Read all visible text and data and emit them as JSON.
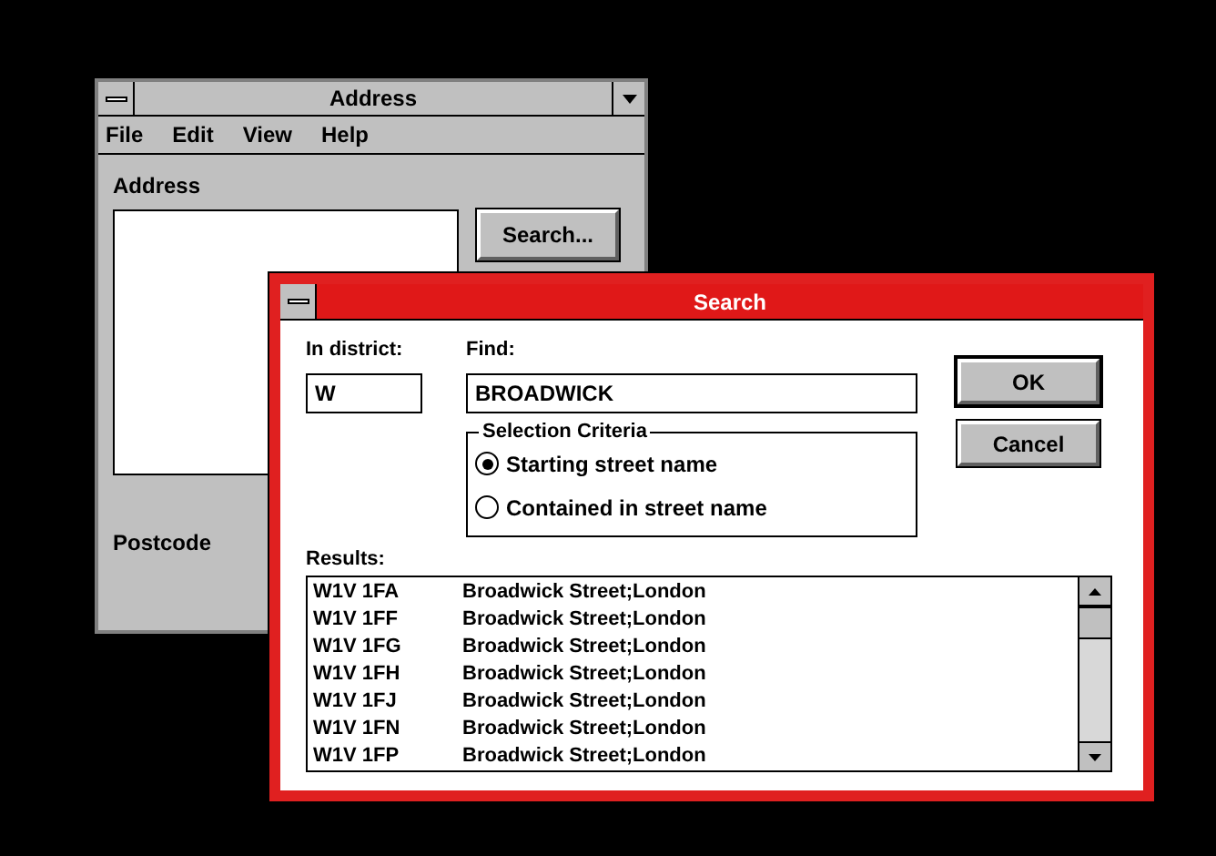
{
  "address_window": {
    "title": "Address",
    "menu": [
      "File",
      "Edit",
      "View",
      "Help"
    ],
    "address_label": "Address",
    "search_button": "Search...",
    "postcode_label": "Postcode"
  },
  "search_dialog": {
    "title": "Search",
    "district_label": "In district:",
    "district_value": "W",
    "find_label": "Find:",
    "find_value": "BROADWICK",
    "criteria_title": "Selection Criteria",
    "criteria": [
      {
        "label": "Starting street name",
        "selected": true
      },
      {
        "label": "Contained in street name",
        "selected": false
      }
    ],
    "buttons": [
      "OK",
      "Cancel"
    ],
    "results_label": "Results:",
    "results": [
      {
        "postcode": "W1V 1FA",
        "street": "Broadwick Street;London"
      },
      {
        "postcode": "W1V 1FF",
        "street": "Broadwick Street;London"
      },
      {
        "postcode": "W1V 1FG",
        "street": "Broadwick Street;London"
      },
      {
        "postcode": "W1V 1FH",
        "street": "Broadwick Street;London"
      },
      {
        "postcode": "W1V 1FJ",
        "street": "Broadwick Street;London"
      },
      {
        "postcode": "W1V 1FN",
        "street": "Broadwick Street;London"
      },
      {
        "postcode": "W1V 1FP",
        "street": "Broadwick Street;London"
      }
    ]
  }
}
